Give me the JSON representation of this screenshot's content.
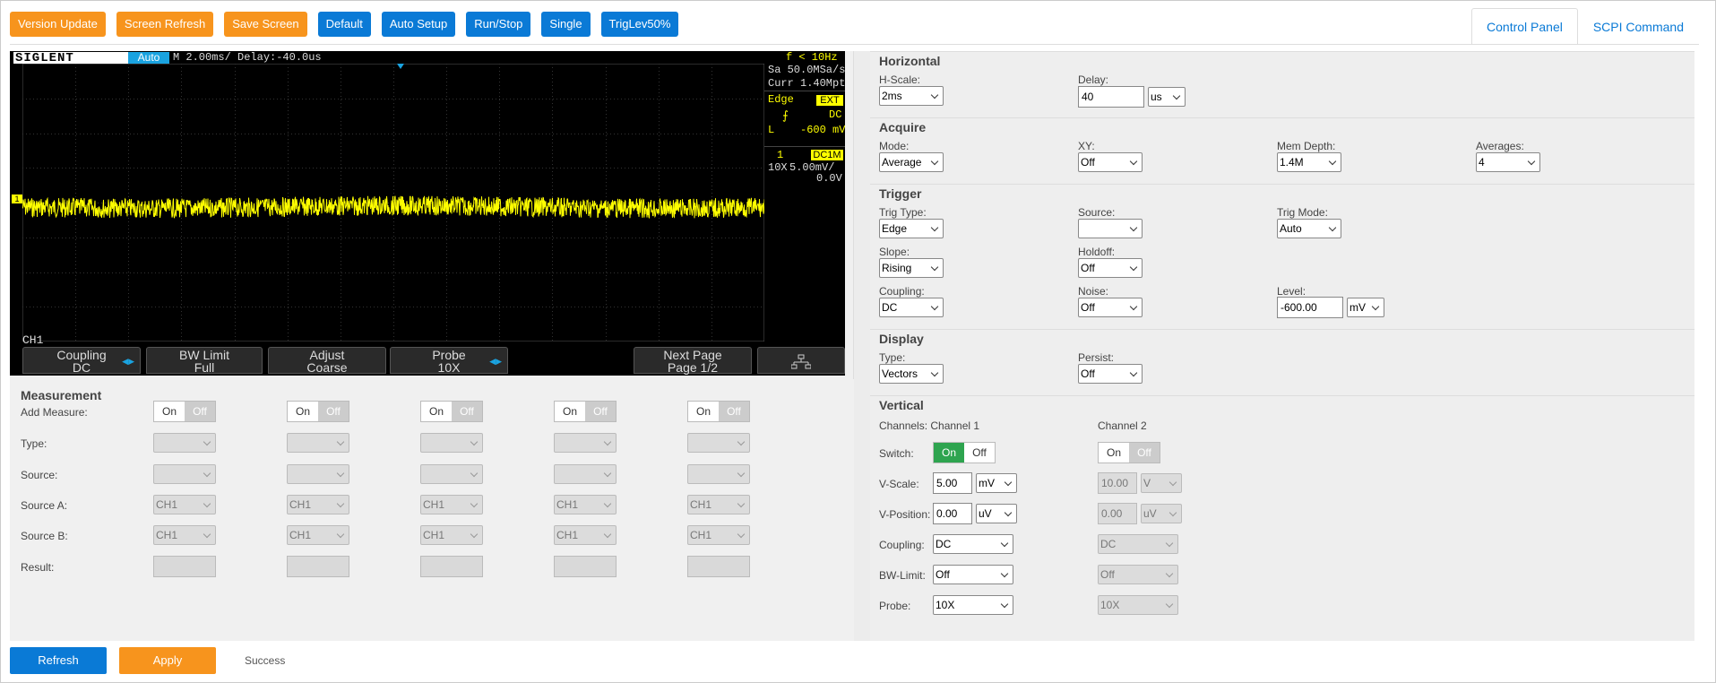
{
  "toolbar": {
    "buttons": [
      {
        "label": "Version Update",
        "color": "#f7941d"
      },
      {
        "label": "Screen Refresh",
        "color": "#f7941d"
      },
      {
        "label": "Save Screen",
        "color": "#f7941d"
      },
      {
        "label": "Default",
        "color": "#0a7ad6"
      },
      {
        "label": "Auto Setup",
        "color": "#0a7ad6"
      },
      {
        "label": "Run/Stop",
        "color": "#0a7ad6"
      },
      {
        "label": "Single",
        "color": "#0a7ad6"
      },
      {
        "label": "TrigLev50%",
        "color": "#0a7ad6"
      }
    ]
  },
  "tabs": [
    {
      "label": "Control Panel",
      "active": true
    },
    {
      "label": "SCPI Command",
      "active": false
    }
  ],
  "scope": {
    "brand": "SIGLENT",
    "mode": "Auto",
    "timebase": "M 2.00ms/ Delay:-40.0us",
    "freq": "f < 10Hz",
    "sample_rate": "Sa 50.0MSa/s",
    "curr": "Curr 1.40Mpts",
    "trig_type": "Edge",
    "trig_src": "EXT",
    "trig_coupling": "DC",
    "trig_level_prefix": "L",
    "trig_level": "-600 mV",
    "ch_num": "1",
    "ch_coupling": "DC1M",
    "ch_probe": "10X",
    "ch_scale": "5.00mV/",
    "ch_offset": "0.0V",
    "ch_label": "CH1",
    "trace_color": "#ffff00",
    "softkeys": [
      {
        "top": "Coupling",
        "bottom": "DC"
      },
      {
        "top": "BW Limit",
        "bottom": "Full"
      },
      {
        "top": "Adjust",
        "bottom": "Coarse"
      },
      {
        "top": "Probe",
        "bottom": "10X"
      },
      {
        "top": "Next Page",
        "bottom": "Page 1/2"
      }
    ]
  },
  "measurement": {
    "title": "Measurement",
    "rows": [
      "Add Measure:",
      "Type:",
      "Source:",
      "Source A:",
      "Source B:",
      "Result:"
    ],
    "on": "On",
    "off": "Off",
    "source_value": "CH1"
  },
  "horizontal": {
    "title": "Horizontal",
    "hscale_label": "H-Scale:",
    "hscale": "2ms",
    "delay_label": "Delay:",
    "delay": "40",
    "delay_unit": "us"
  },
  "acquire": {
    "title": "Acquire",
    "mode_label": "Mode:",
    "mode": "Average",
    "xy_label": "XY:",
    "xy": "Off",
    "mem_label": "Mem Depth:",
    "mem": "1.4M",
    "avg_label": "Averages:",
    "avg": "4"
  },
  "trigger": {
    "title": "Trigger",
    "type_label": "Trig Type:",
    "type": "Edge",
    "source_label": "Source:",
    "source": "",
    "mode_label": "Trig Mode:",
    "mode": "Auto",
    "slope_label": "Slope:",
    "slope": "Rising",
    "holdoff_label": "Holdoff:",
    "holdoff": "Off",
    "coupling_label": "Coupling:",
    "coupling": "DC",
    "noise_label": "Noise:",
    "noise": "Off",
    "level_label": "Level:",
    "level": "-600.00",
    "level_unit": "mV"
  },
  "display": {
    "title": "Display",
    "type_label": "Type:",
    "type": "Vectors",
    "persist_label": "Persist:",
    "persist": "Off"
  },
  "vertical": {
    "title": "Vertical",
    "channels_label": "Channels: Channel 1",
    "ch2_label": "Channel 2",
    "switch_label": "Switch:",
    "vscale_label": "V-Scale:",
    "vpos_label": "V-Position:",
    "coupling_label": "Coupling:",
    "bw_label": "BW-Limit:",
    "probe_label": "Probe:",
    "on": "On",
    "off": "Off",
    "ch1": {
      "vscale": "5.00",
      "vscale_unit": "mV",
      "vpos": "0.00",
      "vpos_unit": "uV",
      "coupling": "DC",
      "bw": "Off",
      "probe": "10X"
    },
    "ch2": {
      "vscale": "10.00",
      "vscale_unit": "V",
      "vpos": "0.00",
      "vpos_unit": "uV",
      "coupling": "DC",
      "bw": "Off",
      "probe": "10X"
    }
  },
  "bottom": {
    "refresh": "Refresh",
    "apply": "Apply",
    "status": "Success"
  }
}
